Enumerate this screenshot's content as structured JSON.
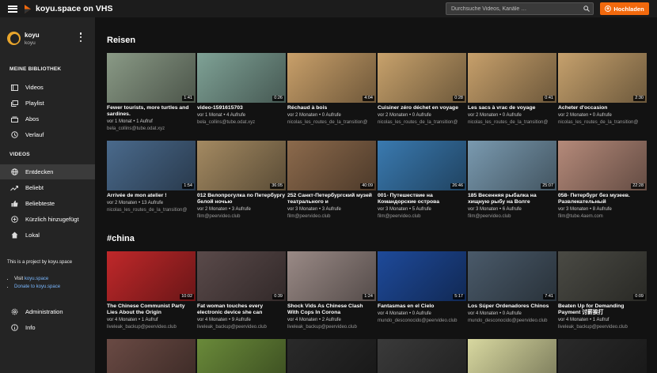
{
  "app": {
    "title": "koyu.space on VHS"
  },
  "search": {
    "placeholder": "Durchsuche Videos, Kanäle …"
  },
  "upload": {
    "label": "Hochladen"
  },
  "user": {
    "name": "koyu",
    "handle": "koyu"
  },
  "library": {
    "title": "MEINE BIBLIOTHEK",
    "items": [
      {
        "label": "Videos",
        "icon": "video-icon"
      },
      {
        "label": "Playlist",
        "icon": "playlist-icon"
      },
      {
        "label": "Abos",
        "icon": "subscriptions-icon"
      },
      {
        "label": "Verlauf",
        "icon": "history-icon"
      }
    ]
  },
  "videos_nav": {
    "title": "VIDEOS",
    "items": [
      {
        "label": "Entdecken",
        "icon": "globe-icon",
        "active": true
      },
      {
        "label": "Beliebt",
        "icon": "trending-icon"
      },
      {
        "label": "Beliebteste",
        "icon": "thumbs-up-icon"
      },
      {
        "label": "Kürzlich hinzugefügt",
        "icon": "plus-circle-icon"
      },
      {
        "label": "Lokal",
        "icon": "home-icon"
      }
    ]
  },
  "promo": {
    "text": "This is a project by koyu.space",
    "visit_prefix": "Visit ",
    "visit_link": "koyu.space",
    "donate_link": "Donate to koyu.space"
  },
  "footer_nav": [
    {
      "label": "Administration",
      "icon": "gear-icon"
    },
    {
      "label": "Info",
      "icon": "info-icon"
    }
  ],
  "sections": [
    {
      "title": "Reisen",
      "rows": [
        [
          {
            "title": "Fewer tourists, more turtles and sardines.",
            "meta": "vor 1 Monat • 1 Aufruf",
            "channel": "bela_collins@tube.odat.xyz",
            "duration": "1:41",
            "color": "#8a9a86"
          },
          {
            "title": "video-1591615703",
            "meta": "vor 1 Monat • 4 Aufrufe",
            "channel": "bela_collins@tube.odat.xyz",
            "duration": "0:26",
            "color": "#7fa296"
          },
          {
            "title": "Réchaud à bois",
            "meta": "vor 2 Monaten • 0 Aufrufe",
            "channel": "nicolas_les_routes_de_la_transition@",
            "duration": "4:04",
            "color": "#c9a06a"
          },
          {
            "title": "Cuisiner zéro déchet en voyage",
            "meta": "vor 2 Monaten • 0 Aufrufe",
            "channel": "nicolas_les_routes_de_la_transition@",
            "duration": "0:28",
            "color": "#c8a26c"
          },
          {
            "title": "Les sacs à vrac de voyage",
            "meta": "vor 2 Monaten • 0 Aufrufe",
            "channel": "nicolas_les_routes_de_la_transition@",
            "duration": "0:41",
            "color": "#c7a06b"
          },
          {
            "title": "Acheter d'occasion",
            "meta": "vor 2 Monaten • 0 Aufrufe",
            "channel": "nicolas_les_routes_de_la_transition@",
            "duration": "2:30",
            "color": "#c6a16d"
          }
        ],
        [
          {
            "title": "Arrivée de mon atelier !",
            "meta": "vor 2 Monaten • 13 Aufrufe",
            "channel": "nicolas_les_routes_de_la_transition@",
            "duration": "1:54",
            "color": "#4a6a8c"
          },
          {
            "title": "012 Велопрогулка по Петербургу белой ночью",
            "meta": "vor 2 Monaten • 3 Aufrufe",
            "channel": "film@peervideo.club",
            "duration": "36:05",
            "color": "#a48a62"
          },
          {
            "title": "252 Санкт-Петербургский музей театрального и",
            "meta": "vor 3 Monaten • 3 Aufrufe",
            "channel": "film@peervideo.club",
            "duration": "40:09",
            "color": "#8c6a4c"
          },
          {
            "title": "001- Путешествие на Командорские острова",
            "meta": "vor 3 Monaten • 5 Aufrufe",
            "channel": "film@peervideo.club",
            "duration": "26:46",
            "color": "#3a7ab0"
          },
          {
            "title": "185 Весенняя рыбалка на хищную рыбу на Волге",
            "meta": "vor 3 Monaten • 6 Aufrufe",
            "channel": "film@peervideo.club",
            "duration": "25:07",
            "color": "#7a9ab0"
          },
          {
            "title": "058- Петербург без музеев. Развлекательный",
            "meta": "vor 3 Monaten • 8 Aufrufe",
            "channel": "film@tube.4aem.com",
            "duration": "22:28",
            "color": "#b58a7a"
          }
        ]
      ]
    },
    {
      "title": "#china",
      "rows": [
        [
          {
            "title": "The Chinese Communist Party Lies About the Origin",
            "meta": "vor 4 Monaten • 1 Aufruf",
            "channel": "liveleak_backup@peervideo.club",
            "duration": "10:02",
            "color": "#c0282a"
          },
          {
            "title": "Fat woman touches every electronic device she can",
            "meta": "vor 4 Monaten • 9 Aufrufe",
            "channel": "liveleak_backup@peervideo.club",
            "duration": "0:39",
            "color": "#5a4a4a"
          },
          {
            "title": "Shock Vids As Chinese Clash With Cops In Corona",
            "meta": "vor 4 Monaten • 2 Aufrufe",
            "channel": "liveleak_backup@peervideo.club",
            "duration": "1:24",
            "color": "#9a8a86"
          },
          {
            "title": "Fantasmas en el Cielo",
            "meta": "vor 4 Monaten • 0 Aufrufe",
            "channel": "mundo_desconocido@peervideo.club",
            "duration": "5:17",
            "color": "#1e4a9a"
          },
          {
            "title": "Los Súper Ordenadores Chinos",
            "meta": "vor 4 Monaten • 0 Aufrufe",
            "channel": "mundo_desconocido@peervideo.club",
            "duration": "7:41",
            "color": "#4a5a6a"
          },
          {
            "title": "Beaten Up for Demanding Payment 讨薪挨打",
            "meta": "vor 4 Monaten • 1 Aufruf",
            "channel": "liveleak_backup@peervideo.club",
            "duration": "0:09",
            "color": "#4a4a44"
          }
        ],
        [
          {
            "title": "",
            "meta": "",
            "channel": "",
            "duration": "",
            "color": "#6a4a44"
          },
          {
            "title": "",
            "meta": "",
            "channel": "",
            "duration": "",
            "color": "#6a8a3a"
          },
          {
            "title": "",
            "meta": "",
            "channel": "",
            "duration": "",
            "color": "#2a2a2a"
          },
          {
            "title": "",
            "meta": "",
            "channel": "",
            "duration": "",
            "color": "#3a3a3a"
          },
          {
            "title": "",
            "meta": "",
            "channel": "",
            "duration": "",
            "color": "#d8d8a0"
          },
          {
            "title": "",
            "meta": "",
            "channel": "",
            "duration": "",
            "color": "#2a2a2a"
          }
        ]
      ]
    }
  ]
}
